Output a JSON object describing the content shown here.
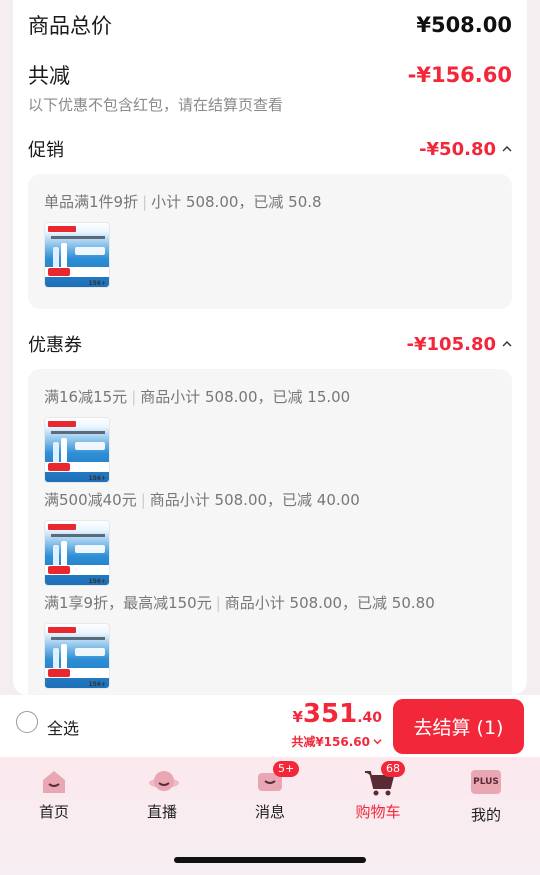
{
  "summary": {
    "goods_total_label": "商品总价",
    "goods_total_value": "¥508.00",
    "total_reduce_label": "共减",
    "total_reduce_value": "-¥156.60",
    "hint": "以下优惠不包含红包，请在结算页查看"
  },
  "promotion": {
    "title": "促销",
    "amount": "-¥50.80",
    "rules": [
      {
        "name": "单品满1件9折",
        "detail": "小计 508.00，已减 50.8"
      }
    ]
  },
  "coupon": {
    "title": "优惠券",
    "amount": "-¥105.80",
    "rules": [
      {
        "name": "满16减15元",
        "detail": "商品小计 508.00，已减 15.00"
      },
      {
        "name": "满500减40元",
        "detail": "商品小计 508.00，已减 40.00"
      },
      {
        "name": "满1享9折，最高减150元",
        "detail": "商品小计 508.00，已减 50.80"
      }
    ]
  },
  "checkout": {
    "select_all_label": "全选",
    "yen": "¥",
    "total_int": "351",
    "total_dec": ".40",
    "saved_label": "共减¥156.60",
    "pay_button_label": "去结算 (1)"
  },
  "tabbar": {
    "items": [
      {
        "label": "首页",
        "icon": "home-icon"
      },
      {
        "label": "直播",
        "icon": "live-icon"
      },
      {
        "label": "消息",
        "icon": "message-icon",
        "badge": "5+"
      },
      {
        "label": "购物车",
        "icon": "cart-icon",
        "badge": "68"
      },
      {
        "label": "我的",
        "icon": "plus-profile-icon",
        "plus": "PLUS"
      }
    ]
  },
  "colors": {
    "accent": "#f2273a",
    "text": "#1a1a1a",
    "muted": "#8a8a8a"
  }
}
